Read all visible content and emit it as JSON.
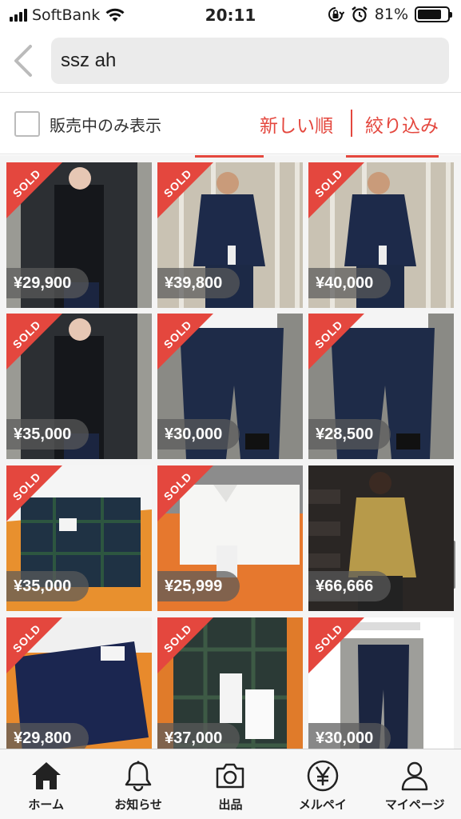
{
  "status_bar": {
    "carrier": "SoftBank",
    "time": "20:11",
    "battery": "81%",
    "battery_level": 0.81
  },
  "search": {
    "query": "ssz ah"
  },
  "filter": {
    "checkbox_label": "販売中のみ表示",
    "sort_label": "新しい順",
    "filter_label": "絞り込み"
  },
  "sold_label": "SOLD",
  "items": [
    {
      "price": "¥29,900",
      "sold": true,
      "photo": "black-shirt"
    },
    {
      "price": "¥39,800",
      "sold": true,
      "photo": "navy-jacket"
    },
    {
      "price": "¥40,000",
      "sold": true,
      "photo": "navy-jacket"
    },
    {
      "price": "¥35,000",
      "sold": true,
      "photo": "black-shirt"
    },
    {
      "price": "¥30,000",
      "sold": true,
      "photo": "navy-pants"
    },
    {
      "price": "¥28,500",
      "sold": true,
      "photo": "navy-pants"
    },
    {
      "price": "¥35,000",
      "sold": true,
      "photo": "plaid-shirt-folded"
    },
    {
      "price": "¥25,999",
      "sold": true,
      "photo": "white-shirt-box"
    },
    {
      "price": "¥66,666",
      "sold": false,
      "photo": "khaki-jacket"
    },
    {
      "price": "¥29,800",
      "sold": true,
      "photo": "navy-folded"
    },
    {
      "price": "¥37,000",
      "sold": true,
      "photo": "plaid-shirt-tags"
    },
    {
      "price": "¥30,000",
      "sold": true,
      "photo": "screenshot-pants"
    }
  ],
  "tabs": [
    {
      "label": "ホーム",
      "icon": "home-icon"
    },
    {
      "label": "お知らせ",
      "icon": "bell-icon"
    },
    {
      "label": "出品",
      "icon": "camera-icon"
    },
    {
      "label": "メルペイ",
      "icon": "yen-icon"
    },
    {
      "label": "マイページ",
      "icon": "person-icon"
    }
  ]
}
